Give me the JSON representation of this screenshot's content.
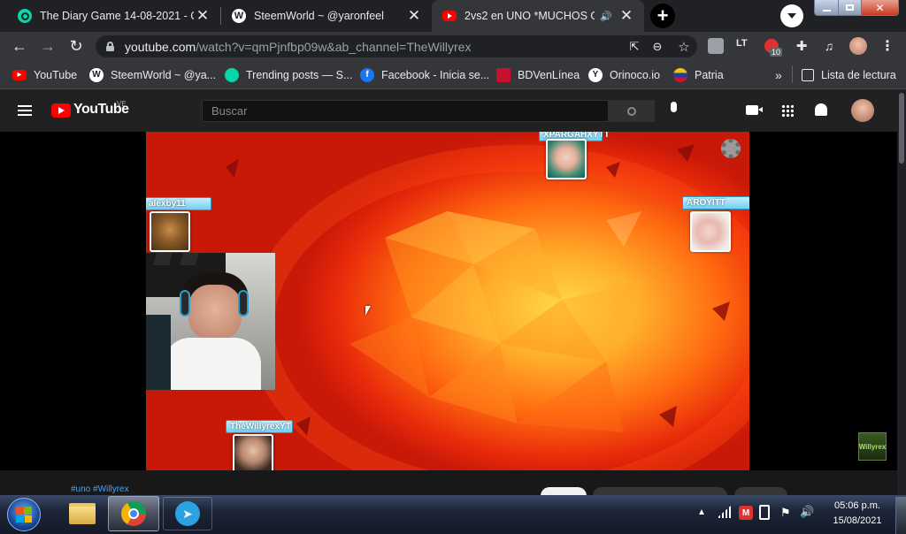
{
  "tabs": [
    {
      "title": "The Diary Game 14-08-2021 - Co",
      "icon": "steemit-icon",
      "close": "✕"
    },
    {
      "title": "SteemWorld ~ @yaronfeel",
      "icon": "wordpress-icon",
      "close": "✕"
    },
    {
      "title": "2vs2 en UNO *MUCHOS GRI",
      "icon": "youtube-icon",
      "close": "✕",
      "audio": "🔊"
    }
  ],
  "new_tab": "+",
  "address": {
    "host": "youtube.com",
    "path": "/watch?v=qmPjnfbp09w&ab_channel=TheWillyrex"
  },
  "extensions": {
    "badge": "10"
  },
  "bookmarks": [
    {
      "label": "YouTube",
      "icon": "youtube-icon",
      "color": "#ff0000"
    },
    {
      "label": "SteemWorld ~ @ya...",
      "icon": "wordpress-icon",
      "color": "#3a4a5a"
    },
    {
      "label": "Trending posts — S...",
      "icon": "steemit-icon",
      "color": "#06d6a9"
    },
    {
      "label": "Facebook - Inicia se...",
      "icon": "facebook-icon",
      "color": "#1877f2"
    },
    {
      "label": "BDVenLínea",
      "icon": "bdv-icon",
      "color": "#c8102e"
    },
    {
      "label": "Orinoco.io",
      "icon": "orinoco-icon",
      "color": "#ffffff"
    },
    {
      "label": "Patria",
      "icon": "patria-icon",
      "color": "#f4c20d"
    }
  ],
  "bookmarks_more": "»",
  "reading_list": "Lista de lectura",
  "youtube": {
    "logo": "YouTube",
    "region": "VE",
    "search_placeholder": "Buscar"
  },
  "video": {
    "players": [
      {
        "name": "XPARGAHXYTT"
      },
      {
        "name": "alexby11"
      },
      {
        "name": "AROYITT"
      },
      {
        "name": "TheWillyrexYT"
      }
    ],
    "watermark": "Willyrex"
  },
  "hashtags": "#uno #Willyrex",
  "clock": {
    "time": "05:06 p.m.",
    "date": "15/08/2021"
  },
  "colors": {
    "tabbar": "#202124",
    "toolbar": "#35363a",
    "yt_header": "#212121",
    "yt_red": "#ff0000",
    "accent_link": "#3ea6ff"
  }
}
